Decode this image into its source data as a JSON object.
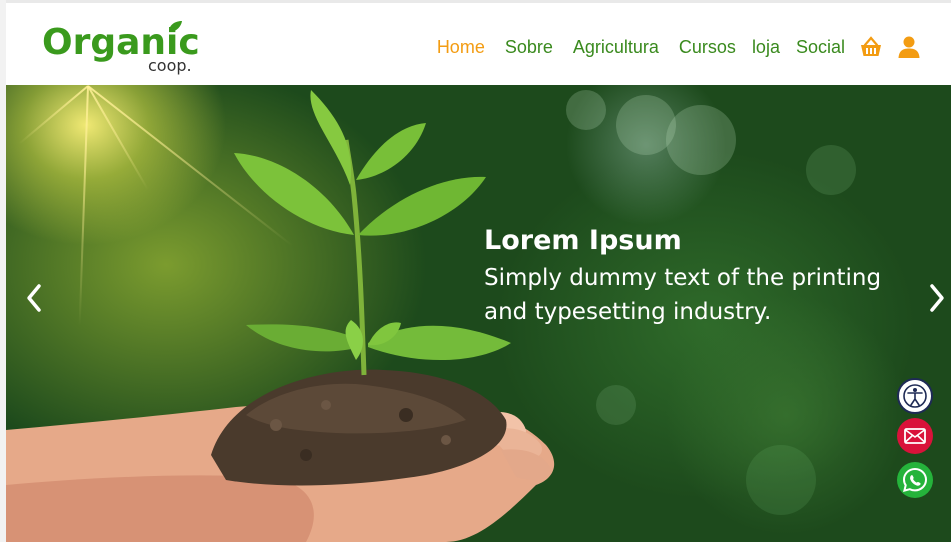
{
  "brand": {
    "name": "Organic",
    "sub": "coop."
  },
  "nav": {
    "items": [
      {
        "label": "Home",
        "active": true
      },
      {
        "label": "Sobre",
        "active": false
      },
      {
        "label": "Agricultura",
        "active": false
      },
      {
        "label": "Cursos",
        "active": false
      },
      {
        "label": "loja",
        "active": false
      },
      {
        "label": "Social",
        "active": false
      }
    ],
    "icons": [
      "basket-icon",
      "user-icon"
    ]
  },
  "hero": {
    "title": "Lorem Ipsum",
    "description": "Simply dummy text of the printing and typesetting industry."
  },
  "floating": [
    "accessibility-icon",
    "mail-icon",
    "whatsapp-icon"
  ],
  "colors": {
    "brand_green": "#3a9a1d",
    "nav_green": "#3a8a1e",
    "accent_orange": "#f39c12",
    "mail_red": "#d9123a",
    "whatsapp_green": "#25b33b"
  }
}
